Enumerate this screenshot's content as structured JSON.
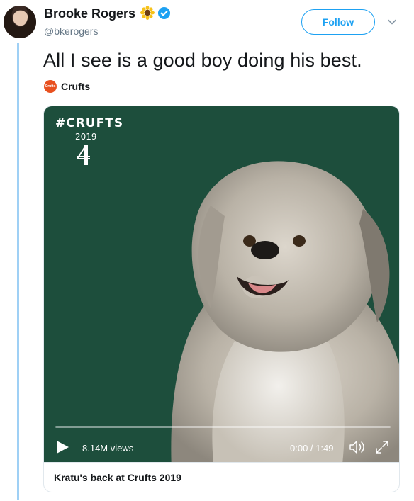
{
  "user": {
    "name": "Brooke Rogers",
    "handle": "@bkerogers",
    "name_emoji_icon": "sunflower-icon",
    "verified_icon": "verified-badge-icon"
  },
  "follow_button": {
    "label": "Follow"
  },
  "menu_icon": "chevron-down-icon",
  "tweet": {
    "text": "All I see is a good boy doing his best."
  },
  "source": {
    "name": "Crufts",
    "logo_text": "Crufts"
  },
  "video": {
    "overlay_hashtag": "#CRUFTS",
    "overlay_year": "2019",
    "channel_logo_icon": "channel-4-logo",
    "views": "8.14M views",
    "time": "0:00 / 1:49",
    "progress": 0,
    "title": "Kratu's back at Crufts 2019"
  },
  "colors": {
    "accent": "#1da1f2",
    "thread_line": "#9fd0f5",
    "video_background": "#1d4e3c"
  }
}
